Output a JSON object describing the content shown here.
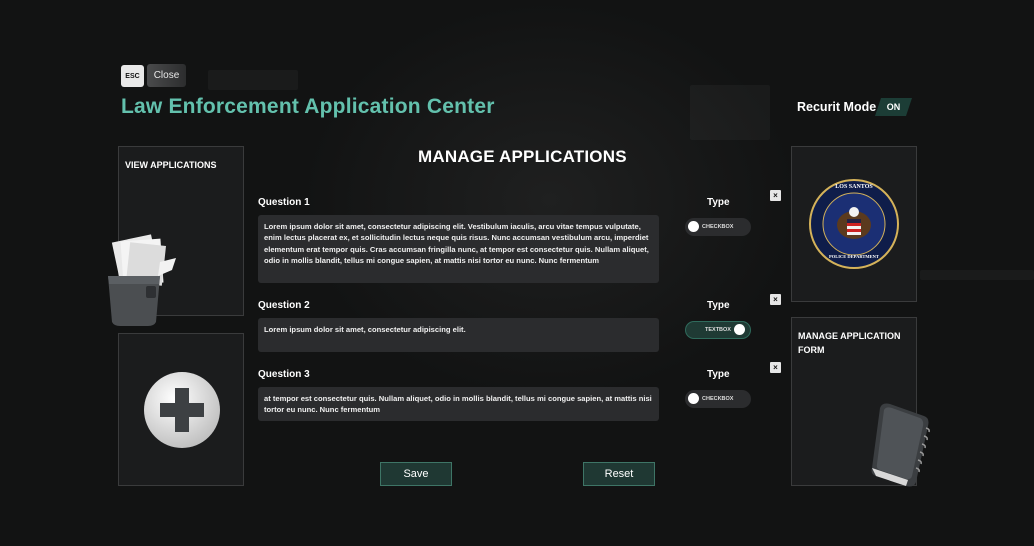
{
  "header": {
    "esc_key": "ESC",
    "close_label": "Close",
    "title": "Law Enforcement Application Center",
    "recruit_mode_label": "Recurit Mode",
    "recruit_mode_state": "ON"
  },
  "left_panels": {
    "view_applications": "VIEW APPLICATIONS"
  },
  "right_panels": {
    "seal_text_top": "LOS SANTOS",
    "seal_text_bottom": "POLICE DEPARTMENT",
    "manage_form": "MANAGE APPLICATION FORM"
  },
  "main": {
    "title": "MANAGE APPLICATIONS",
    "type_label": "Type",
    "questions": [
      {
        "label": "Question 1",
        "text": "Lorem ipsum dolor sit amet, consectetur adipiscing elit. Vestibulum iaculis, arcu vitae tempus vulputate, enim lectus placerat ex, et sollicitudin lectus neque quis risus. Nunc accumsan vestibulum arcu, imperdiet elementum erat tempor quis. Cras accumsan fringilla nunc, at tempor est consectetur quis. Nullam aliquet, odio in mollis blandit, tellus mi congue sapien, at mattis nisi tortor eu nunc. Nunc fermentum",
        "type": "CHECKBOX"
      },
      {
        "label": "Question 2",
        "text": "Lorem ipsum dolor sit amet, consectetur adipiscing elit.",
        "type": "TEXTBOX"
      },
      {
        "label": "Question 3",
        "text": "at tempor est consectetur quis. Nullam aliquet, odio in mollis blandit, tellus mi congue sapien, at mattis nisi tortor eu nunc. Nunc fermentum",
        "type": "CHECKBOX"
      }
    ],
    "delete_symbol": "×",
    "save_label": "Save",
    "reset_label": "Reset"
  },
  "colors": {
    "accent": "#63c1ad",
    "toggle_on": "#1f3a34",
    "button_bg": "#1f3833"
  }
}
